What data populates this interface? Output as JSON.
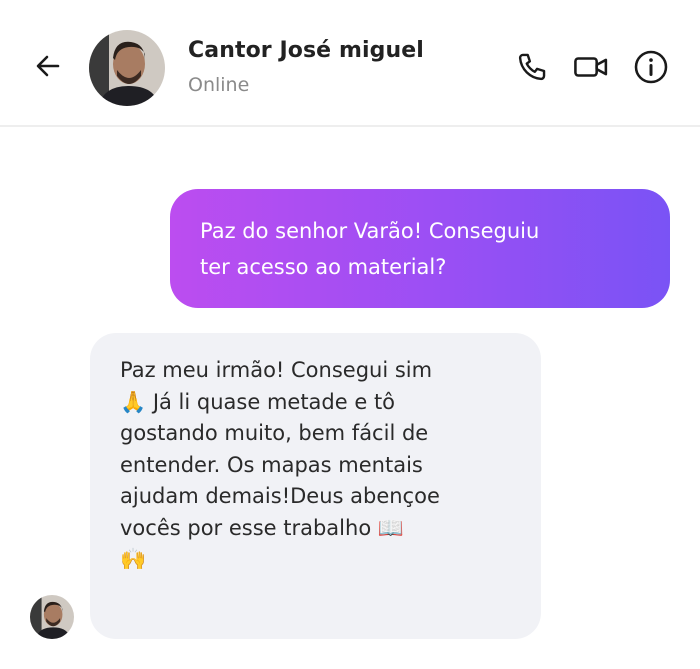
{
  "header": {
    "back_icon": "arrow-left-icon",
    "contact_name": "Cantor José miguel",
    "status": "Online",
    "actions": [
      "phone-icon",
      "video-camera-icon",
      "info-icon"
    ]
  },
  "messages": [
    {
      "direction": "outgoing",
      "lines": [
        "Paz do senhor Varão! Conseguiu",
        "ter acesso ao material?"
      ]
    },
    {
      "direction": "incoming",
      "lines": [
        "Paz meu irmão! Consegui sim",
        "🙏 Já li quase metade e tô",
        "gostando muito, bem fácil de",
        "entender. Os mapas mentais",
        "ajudam demais!Deus abençoe",
        "vocês por esse trabalho 📖",
        "🙌"
      ]
    }
  ],
  "colors": {
    "outgoing_gradient_start": "#bc4df0",
    "outgoing_gradient_end": "#7a53f5",
    "incoming_bubble": "#f1f2f6",
    "status_text": "#8a8a8a"
  }
}
